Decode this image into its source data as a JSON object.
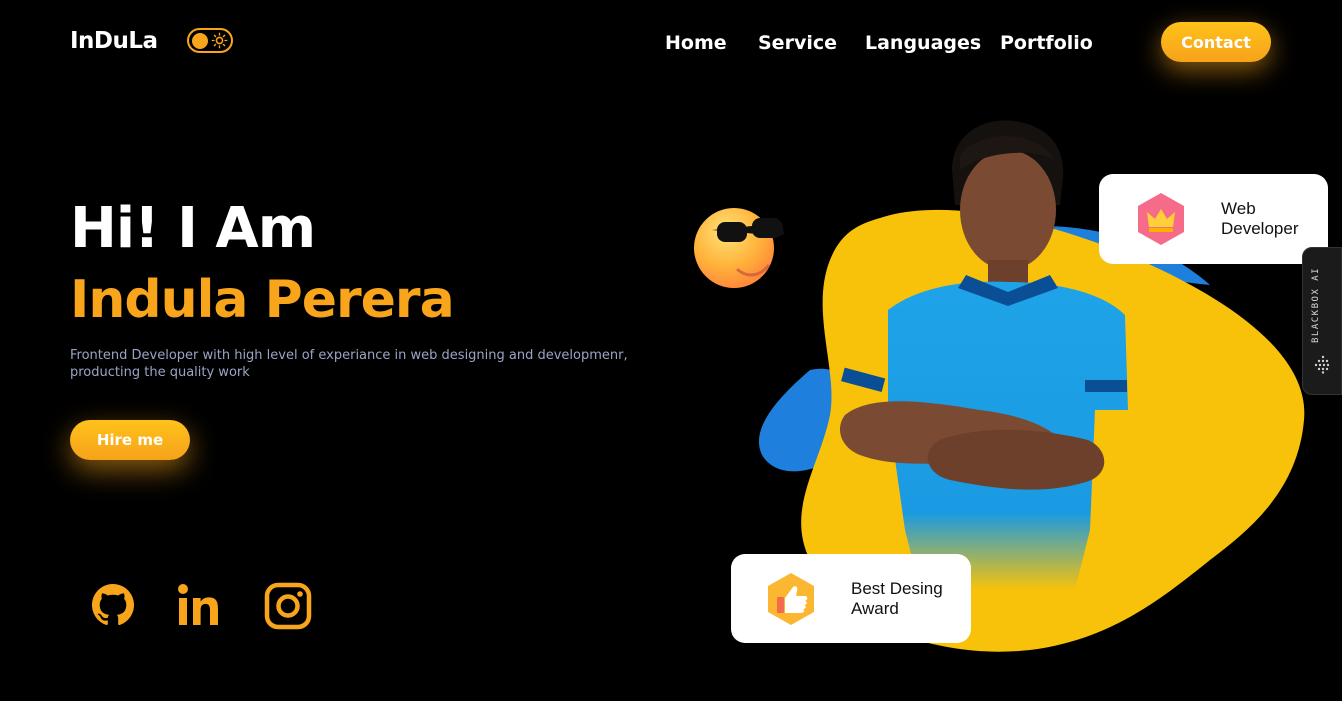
{
  "header": {
    "logo": "InDuLa",
    "theme_toggle_icon": "sun-icon",
    "nav": [
      "Home",
      "Service",
      "Languages",
      "Portfolio"
    ],
    "contact_label": "Contact"
  },
  "hero": {
    "greeting": "Hi! I Am",
    "name": "Indula Perera",
    "description": "Frontend Developer with high level of experiance in web designing and developmenr, producting the quality work",
    "hire_label": "Hire me"
  },
  "social": [
    "github-icon",
    "linkedin-icon",
    "instagram-icon"
  ],
  "cards": {
    "web_developer": "Web Developer",
    "best_design": "Best Desing Award"
  },
  "side_tab": "BLACKBOX AI",
  "colors": {
    "accent": "#f9a51b",
    "blob_yellow": "#f8c20a",
    "blob_blue": "#1e7fdc",
    "background": "#000000",
    "text_muted": "#9ba4c4"
  }
}
